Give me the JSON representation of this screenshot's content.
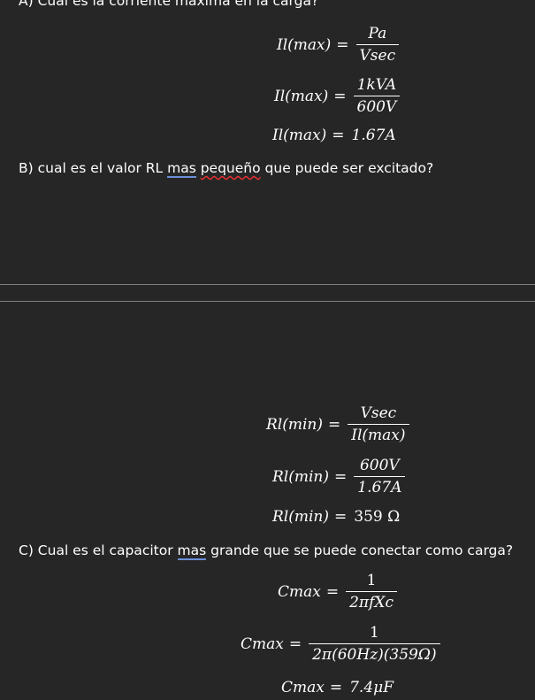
{
  "section_a": {
    "question": "A) Cual es la corriente maxima en la carga?",
    "eq1": {
      "lhs": "Il(max)",
      "eq": "=",
      "num": "Pa",
      "den": "Vsec"
    },
    "eq2": {
      "lhs": "Il(max)",
      "eq": "=",
      "num": "1kVA",
      "den": "600V"
    },
    "eq3": {
      "lhs": "Il(max)",
      "eq": "=",
      "rhs": "1.67A"
    }
  },
  "section_b": {
    "question_pre": "B) cual es el valor RL ",
    "question_mas": "mas",
    "question_space": " ",
    "question_peq": "pequeño",
    "question_post": " que puede ser excitado?",
    "eq1": {
      "lhs": "Rl(min)",
      "eq": "=",
      "num": "Vsec",
      "den": "Il(max)"
    },
    "eq2": {
      "lhs": "Rl(min)",
      "eq": "=",
      "num": "600V",
      "den": "1.67A"
    },
    "eq3": {
      "lhs": "Rl(min)",
      "eq": "=",
      "rhs": "359 Ω"
    }
  },
  "section_c": {
    "question_pre": "C) Cual es el capacitor ",
    "question_mas": "mas",
    "question_post": " grande que se puede conectar como carga?",
    "eq1": {
      "lhs": "Cmax",
      "eq": "=",
      "num": "1",
      "den": "2πfXc"
    },
    "eq2": {
      "lhs": "Cmax",
      "eq": "=",
      "num": "1",
      "den": "2π(60Hz)(359Ω)"
    },
    "eq3": {
      "lhs": "Cmax",
      "eq": "=",
      "rhs": "7.4μF"
    }
  }
}
